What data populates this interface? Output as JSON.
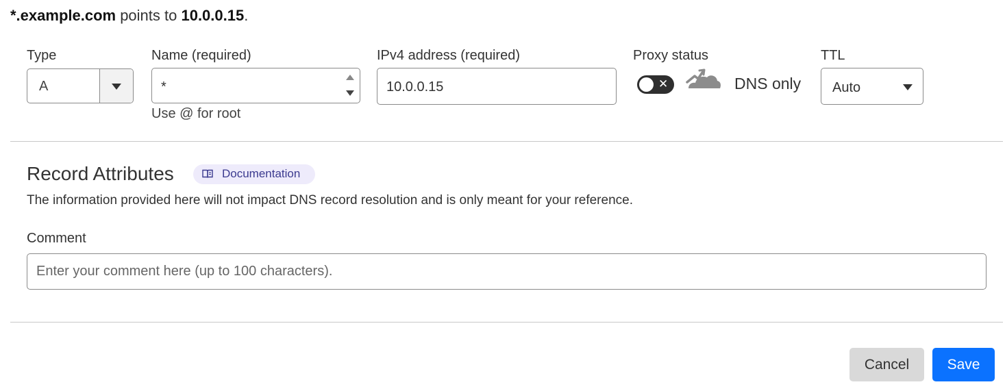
{
  "summary": {
    "name": "*.example.com",
    "middle": " points to ",
    "target": "10.0.0.15",
    "end": "."
  },
  "fields": {
    "type": {
      "label": "Type",
      "value": "A"
    },
    "name": {
      "label": "Name (required)",
      "value": "*",
      "hint": "Use @ for root"
    },
    "ipv4": {
      "label": "IPv4 address (required)",
      "value": "10.0.0.15"
    },
    "proxy": {
      "label": "Proxy status",
      "toggle_symbol": "✕",
      "status_text": "DNS only",
      "enabled": false
    },
    "ttl": {
      "label": "TTL",
      "value": "Auto"
    }
  },
  "record_attributes": {
    "title": "Record Attributes",
    "doc_link": "Documentation",
    "description": "The information provided here will not impact DNS record resolution and is only meant for your reference.",
    "comment_label": "Comment",
    "comment_placeholder": "Enter your comment here (up to 100 characters)."
  },
  "actions": {
    "cancel": "Cancel",
    "save": "Save"
  },
  "colors": {
    "save_bg": "#0b72ff",
    "cancel_bg": "#d9d9d9",
    "doc_pill_bg": "#eeebfb",
    "doc_pill_text": "#3b3a8f",
    "toggle_off": "#2f2f2f",
    "cloud_gray": "#8c8c8c"
  }
}
